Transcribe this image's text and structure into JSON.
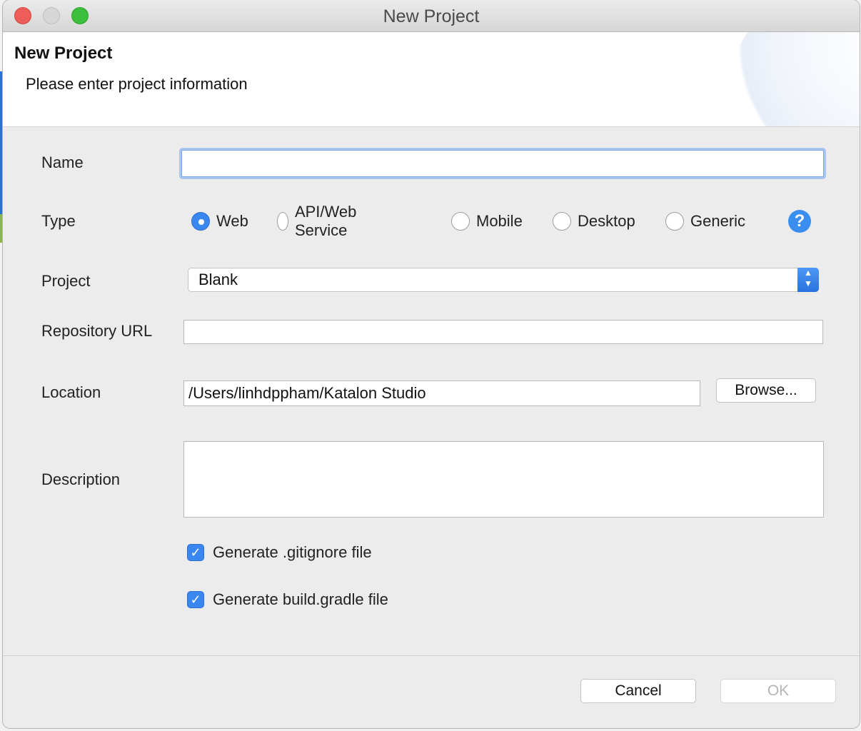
{
  "window": {
    "title": "New Project"
  },
  "header": {
    "title": "New Project",
    "subtitle": "Please enter project information"
  },
  "form": {
    "name": {
      "label": "Name",
      "value": ""
    },
    "type": {
      "label": "Type",
      "options": [
        "Web",
        "API/Web Service",
        "Mobile",
        "Desktop",
        "Generic"
      ],
      "selected": "Web"
    },
    "project": {
      "label": "Project",
      "value": "Blank"
    },
    "repository_url": {
      "label": "Repository URL",
      "value": ""
    },
    "location": {
      "label": "Location",
      "value": "/Users/linhdppham/Katalon Studio",
      "browse_label": "Browse..."
    },
    "description": {
      "label": "Description",
      "value": ""
    },
    "gitignore": {
      "label": "Generate .gitignore file",
      "checked": true
    },
    "gradle": {
      "label": "Generate build.gradle file",
      "checked": true
    }
  },
  "footer": {
    "cancel_label": "Cancel",
    "ok_label": "OK"
  },
  "icons": {
    "help": "question-mark",
    "select_arrows": "up-down-chevrons",
    "checkmark": "check"
  },
  "colors": {
    "accent": "#3b87f0",
    "close": "#ee5d57",
    "maximize": "#3dbf3e"
  }
}
